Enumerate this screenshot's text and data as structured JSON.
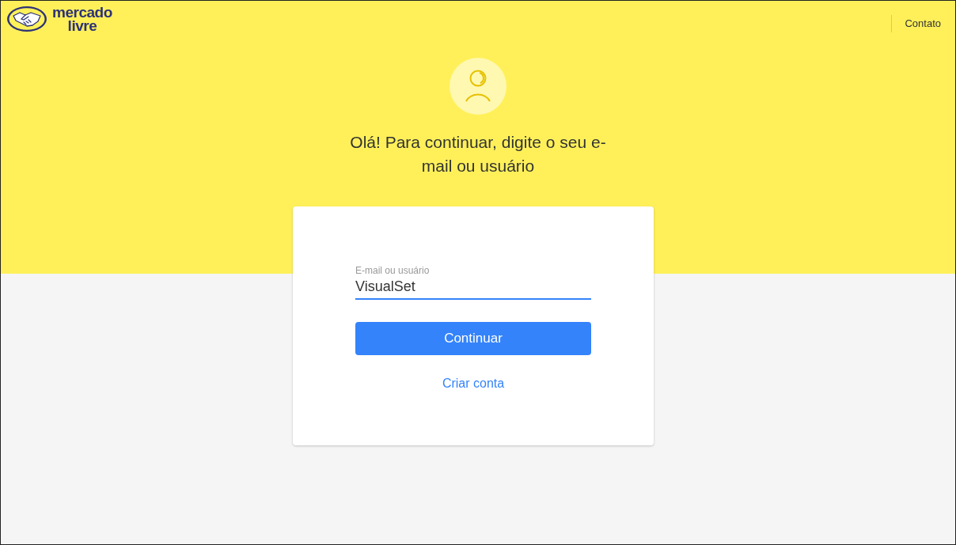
{
  "header": {
    "logo_lines": [
      "mercado",
      "livre"
    ],
    "contact_link": "Contato"
  },
  "heading": "Olá! Para continuar, digite o seu e-mail ou usuário",
  "login_form": {
    "field": {
      "label": "E-mail ou usuário",
      "value": "VisualSet",
      "focused": true
    },
    "continue_button": "Continuar",
    "create_account_link": "Criar conta"
  }
}
